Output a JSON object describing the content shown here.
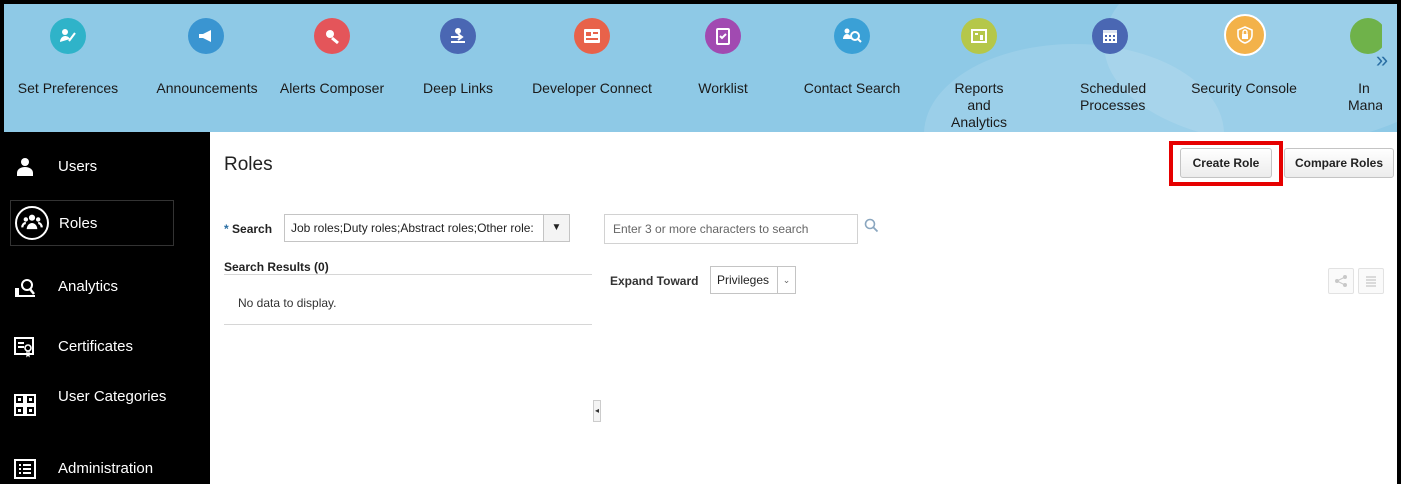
{
  "springboard": {
    "items": [
      {
        "label": "Set Preferences",
        "icon": "preferences-icon",
        "color": "#2fb3c9"
      },
      {
        "label": "Announcements",
        "icon": "megaphone-icon",
        "color": "#3a95d1"
      },
      {
        "label": "Alerts Composer",
        "icon": "alerts-composer-icon",
        "color": "#e4555a"
      },
      {
        "label": "Deep Links",
        "icon": "deep-links-icon",
        "color": "#4a67b3"
      },
      {
        "label": "Developer Connect",
        "icon": "developer-connect-icon",
        "color": "#e8624a"
      },
      {
        "label": "Worklist",
        "icon": "worklist-icon",
        "color": "#a14ab1"
      },
      {
        "label": "Contact Search",
        "icon": "contact-search-icon",
        "color": "#3aa0d6"
      },
      {
        "label": "Reports and Analytics",
        "icon": "reports-icon",
        "color": "#b5c74a"
      },
      {
        "label": "Scheduled Processes",
        "icon": "calendar-icon",
        "color": "#4a67b3"
      },
      {
        "label": "Security Console",
        "icon": "shield-icon",
        "color": "#f3b24a"
      },
      {
        "label": "In Mana",
        "icon": "partial-app-icon",
        "color": "#6fb24a"
      }
    ],
    "next_label": "»"
  },
  "nav": {
    "items": [
      {
        "label": "Users",
        "icon": "user-icon"
      },
      {
        "label": "Roles",
        "icon": "roles-icon"
      },
      {
        "label": "Analytics",
        "icon": "analytics-icon"
      },
      {
        "label": "Certificates",
        "icon": "certificate-icon"
      },
      {
        "label": "User Categories",
        "icon": "grid-icon"
      },
      {
        "label": "Administration",
        "icon": "list-icon"
      }
    ]
  },
  "main": {
    "title": "Roles",
    "create_role_label": "Create Role",
    "compare_roles_label": "Compare Roles",
    "search_label": "Search",
    "search_required_mark": "*",
    "search_scope_value": "Job roles;Duty roles;Abstract roles;Other role:",
    "search_placeholder": "Enter 3 or more characters to search",
    "results_header": "Search Results (0)",
    "no_data": "No data to display.",
    "expand_label": "Expand Toward",
    "expand_value": "Privileges"
  },
  "colors": {
    "springboard_bg": "#8ec9e6",
    "highlight": "#e60000",
    "nav_bg": "#000000"
  }
}
